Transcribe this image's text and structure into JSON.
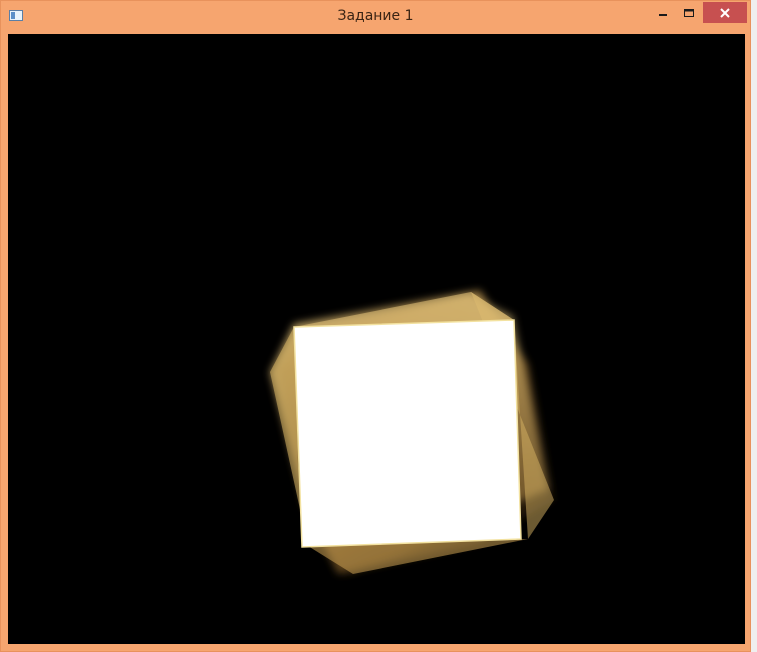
{
  "window": {
    "title": "Задание 1",
    "frame_color": "#f6a56f",
    "close_color": "#c75050"
  },
  "icons": {
    "app": "app-window-icon",
    "minimize": "minimize-icon",
    "maximize": "maximize-icon",
    "close": "close-icon"
  },
  "scene": {
    "background": "#000000",
    "square_color": "#ffffff",
    "glow_color": "#e8c778",
    "motion_trail": true
  }
}
